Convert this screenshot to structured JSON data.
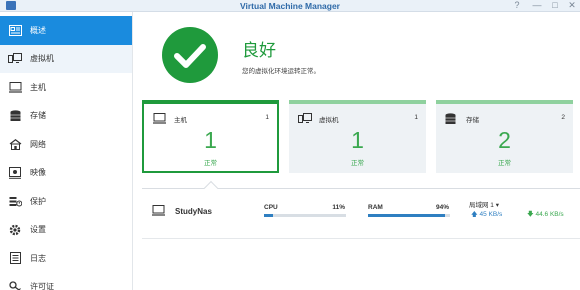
{
  "window": {
    "title": "Virtual Machine Manager",
    "help": "?",
    "minimize": "—",
    "maximize": "□",
    "close": "✕"
  },
  "sidebar": {
    "items": [
      {
        "label": "概述",
        "icon": "overview-icon"
      },
      {
        "label": "虚拟机",
        "icon": "virtual-machine-icon"
      },
      {
        "label": "主机",
        "icon": "host-icon"
      },
      {
        "label": "存储",
        "icon": "storage-icon"
      },
      {
        "label": "网络",
        "icon": "network-icon"
      },
      {
        "label": "映像",
        "icon": "image-icon"
      },
      {
        "label": "保护",
        "icon": "protection-icon"
      },
      {
        "label": "设置",
        "icon": "settings-icon"
      },
      {
        "label": "日志",
        "icon": "log-icon"
      },
      {
        "label": "许可证",
        "icon": "license-icon"
      }
    ],
    "active_index": 0
  },
  "status": {
    "title": "良好",
    "description": "您的虚拟化环境运转正常。"
  },
  "cards": [
    {
      "name": "主机",
      "count": "1",
      "big": "1",
      "status": "正常",
      "icon": "host-icon"
    },
    {
      "name": "虚拟机",
      "count": "1",
      "big": "1",
      "status": "正常",
      "icon": "virtual-machine-icon"
    },
    {
      "name": "存储",
      "count": "2",
      "big": "2",
      "status": "正常",
      "icon": "storage-icon"
    }
  ],
  "host": {
    "name": "StudyNas",
    "cpu_label": "CPU",
    "cpu_value": "11%",
    "cpu_fraction": 0.11,
    "ram_label": "RAM",
    "ram_value": "94%",
    "ram_fraction": 0.94,
    "net_label": "局域网 1 ▾",
    "net_up": "45 KB/s",
    "net_down": "44.6 KB/s"
  },
  "colors": {
    "accent": "#1a8bde",
    "ok": "#1f9a3c",
    "ok_light": "#3aa84f",
    "bar": "#2f7fc1"
  }
}
